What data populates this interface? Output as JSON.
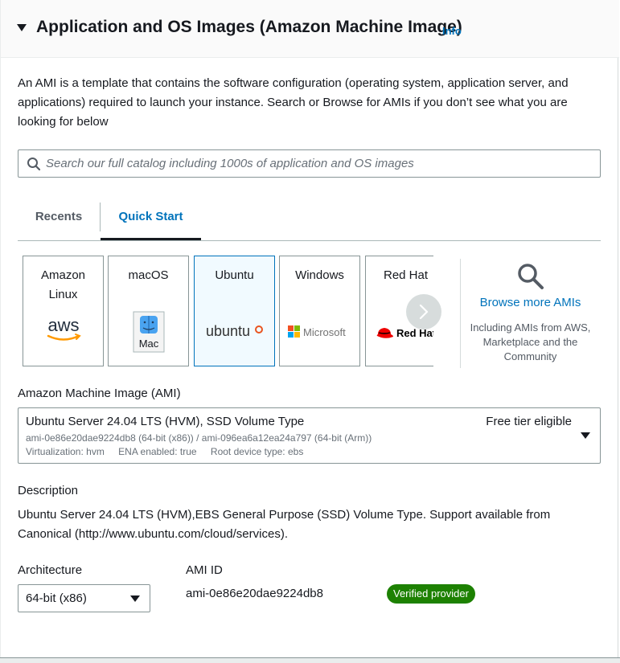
{
  "header": {
    "title": "Application and OS Images (Amazon Machine Image)",
    "info": "Info"
  },
  "intro": "An AMI is a template that contains the software configuration (operating system, application server, and applications) required to launch your instance. Search or Browse for AMIs if you don’t see what you are looking for below",
  "search": {
    "placeholder": "Search our full catalog including 1000s of application and OS images",
    "value": "",
    "icon": "search-icon"
  },
  "tabs": [
    {
      "label": "Recents",
      "selected": false
    },
    {
      "label": "Quick Start",
      "selected": true
    }
  ],
  "cards": [
    {
      "label": "Amazon\nLinux",
      "logo_text": "aws",
      "icon": "aws-logo-icon",
      "selected": false
    },
    {
      "label": "macOS",
      "logo_text": "Mac",
      "icon": "mac-finder-icon",
      "selected": false
    },
    {
      "label": "Ubuntu",
      "logo_text": "ubuntu",
      "icon": "ubuntu-logo-icon",
      "selected": true
    },
    {
      "label": "Windows",
      "logo_text": "Microsoft",
      "icon": "microsoft-logo-icon",
      "selected": false
    },
    {
      "label": "Red Hat",
      "logo_text": "Red Hat",
      "icon": "redhat-logo-icon",
      "selected": false
    }
  ],
  "browse": {
    "link": "Browse more AMIs",
    "subtext": "Including AMIs from AWS, Marketplace and the Community",
    "icon": "search-icon"
  },
  "ami": {
    "label": "Amazon Machine Image (AMI)",
    "name": "Ubuntu Server 24.04 LTS (HVM), SSD Volume Type",
    "free_tier": "Free tier eligible",
    "ids": "ami-0e86e20dae9224db8 (64-bit (x86)) / ami-096ea6a12ea24a797 (64-bit (Arm))",
    "virtualization": "Virtualization: hvm",
    "ena": "ENA enabled: true",
    "root_device": "Root device type: ebs"
  },
  "description": {
    "label": "Description",
    "text": "Ubuntu Server 24.04 LTS (HVM),EBS General Purpose (SSD) Volume Type. Support available from Canonical (http://www.ubuntu.com/cloud/services)."
  },
  "architecture": {
    "label": "Architecture",
    "value": "64-bit (x86)"
  },
  "ami_id": {
    "label": "AMI ID",
    "value": "ami-0e86e20dae9224db8",
    "badge": "Verified provider"
  },
  "colors": {
    "link": "#0073bb",
    "badge": "#1d8102",
    "selected_card_bg": "#f1faff"
  }
}
